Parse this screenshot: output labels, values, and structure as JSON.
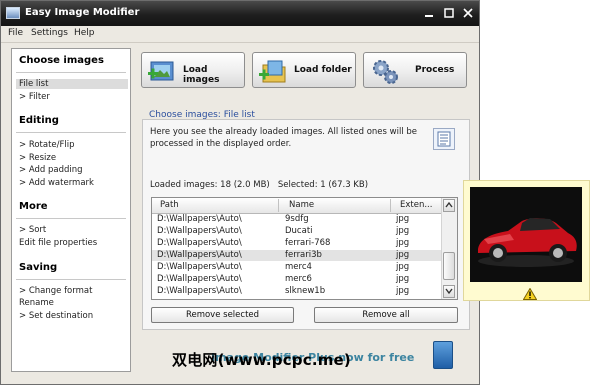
{
  "window": {
    "title": "Easy Image Modifier",
    "controls": {
      "minimize": "–",
      "close": "✕"
    }
  },
  "menu": [
    "File",
    "Settings",
    "Help"
  ],
  "sidebar": {
    "sections": [
      {
        "title": "Choose images",
        "items": [
          "File list",
          "> Filter"
        ]
      },
      {
        "title": "Editing",
        "items": [
          "> Rotate/Flip",
          "> Resize",
          "> Add padding",
          "> Add watermark"
        ]
      },
      {
        "title": "More",
        "items": [
          "> Sort",
          "Edit file properties"
        ]
      },
      {
        "title": "Saving",
        "items": [
          "> Change format",
          "Rename",
          "> Set destination"
        ]
      }
    ],
    "selected": "File list"
  },
  "toolbar": {
    "load_images": "Load images",
    "load_folder": "Load folder",
    "process": "Process"
  },
  "panel": {
    "heading": "Choose images: File list",
    "description": "Here you see the already loaded images. All listed ones will be processed in the displayed order.",
    "loaded_label": "Loaded images: 18 (2.0 MB)",
    "selected_label": "Selected: 1 (67.3 KB)"
  },
  "file_table": {
    "columns": [
      "Path",
      "Name",
      "Exten..."
    ],
    "rows": [
      {
        "path": "D:\\Wallpapers\\Auto\\",
        "name": "9sdfg",
        "ext": "jpg"
      },
      {
        "path": "D:\\Wallpapers\\Auto\\",
        "name": "Ducati",
        "ext": "jpg"
      },
      {
        "path": "D:\\Wallpapers\\Auto\\",
        "name": "ferrari-768",
        "ext": "jpg"
      },
      {
        "path": "D:\\Wallpapers\\Auto\\",
        "name": "ferrari3b",
        "ext": "jpg"
      },
      {
        "path": "D:\\Wallpapers\\Auto\\",
        "name": "merc4",
        "ext": "jpg"
      },
      {
        "path": "D:\\Wallpapers\\Auto\\",
        "name": "merc6",
        "ext": "jpg"
      },
      {
        "path": "D:\\Wallpapers\\Auto\\",
        "name": "slknew1b",
        "ext": "jpg"
      }
    ],
    "selected_row": 3
  },
  "actions": {
    "remove_selected": "Remove selected",
    "remove_all": "Remove all"
  },
  "footer": {
    "promo": "Image Modifier Plus now for free",
    "watermark": "双电网(www.pcpc.me)"
  },
  "colors": {
    "heading_blue": "#2b4f9e",
    "promo_teal": "#3c84a0",
    "titlebar": "#1f1f1f",
    "preview_bg": "#fffbd0"
  }
}
